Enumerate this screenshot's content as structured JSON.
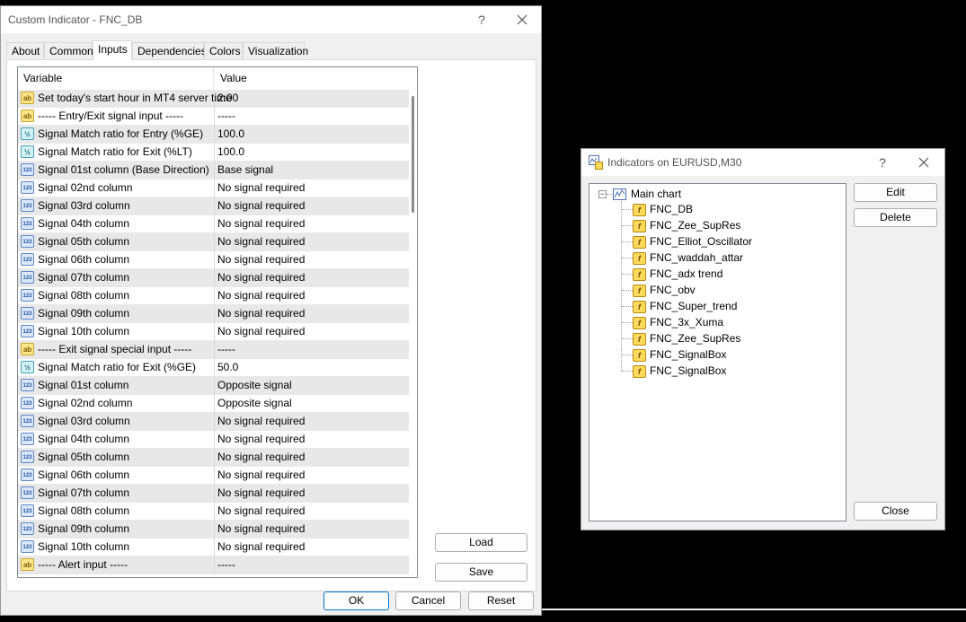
{
  "custom_indicator_dialog": {
    "title": "Custom Indicator - FNC_DB",
    "help_glyph": "?",
    "tabs": [
      {
        "label": "About"
      },
      {
        "label": "Common"
      },
      {
        "label": "Inputs"
      },
      {
        "label": "Dependencies"
      },
      {
        "label": "Colors"
      },
      {
        "label": "Visualization"
      }
    ],
    "active_tab": "Inputs",
    "grid": {
      "col_variable": "Variable",
      "col_value": "Value",
      "rows": [
        {
          "icon": "ab",
          "icon_text": "ab",
          "variable": "Set today's start hour in MT4 server time",
          "value": "2:00"
        },
        {
          "icon": "ab",
          "icon_text": "ab",
          "variable": "----- Entry/Exit signal input -----",
          "value": "-----"
        },
        {
          "icon": "frac",
          "icon_text": "½",
          "variable": "Signal Match ratio for Entry (%GE)",
          "value": "100.0"
        },
        {
          "icon": "frac",
          "icon_text": "½",
          "variable": "Signal Match ratio for Exit (%LT)",
          "value": "100.0"
        },
        {
          "icon": "num",
          "icon_text": "123",
          "variable": "Signal 01st column (Base Direction)",
          "value": "Base signal"
        },
        {
          "icon": "num",
          "icon_text": "123",
          "variable": "Signal 02nd column",
          "value": "No signal required"
        },
        {
          "icon": "num",
          "icon_text": "123",
          "variable": "Signal 03rd column",
          "value": "No signal required"
        },
        {
          "icon": "num",
          "icon_text": "123",
          "variable": "Signal 04th column",
          "value": "No signal required"
        },
        {
          "icon": "num",
          "icon_text": "123",
          "variable": "Signal 05th column",
          "value": "No signal required"
        },
        {
          "icon": "num",
          "icon_text": "123",
          "variable": "Signal 06th column",
          "value": "No signal required"
        },
        {
          "icon": "num",
          "icon_text": "123",
          "variable": "Signal 07th column",
          "value": "No signal required"
        },
        {
          "icon": "num",
          "icon_text": "123",
          "variable": "Signal 08th column",
          "value": "No signal required"
        },
        {
          "icon": "num",
          "icon_text": "123",
          "variable": "Signal 09th column",
          "value": "No signal required"
        },
        {
          "icon": "num",
          "icon_text": "123",
          "variable": "Signal 10th column",
          "value": "No signal required"
        },
        {
          "icon": "ab",
          "icon_text": "ab",
          "variable": "----- Exit signal special input -----",
          "value": "-----"
        },
        {
          "icon": "frac",
          "icon_text": "½",
          "variable": "Signal Match ratio for Exit (%GE)",
          "value": "50.0"
        },
        {
          "icon": "num",
          "icon_text": "123",
          "variable": "Signal 01st column",
          "value": "Opposite signal"
        },
        {
          "icon": "num",
          "icon_text": "123",
          "variable": "Signal 02nd column",
          "value": "Opposite signal"
        },
        {
          "icon": "num",
          "icon_text": "123",
          "variable": "Signal 03rd column",
          "value": "No signal required"
        },
        {
          "icon": "num",
          "icon_text": "123",
          "variable": "Signal 04th column",
          "value": "No signal required"
        },
        {
          "icon": "num",
          "icon_text": "123",
          "variable": "Signal 05th column",
          "value": "No signal required"
        },
        {
          "icon": "num",
          "icon_text": "123",
          "variable": "Signal 06th column",
          "value": "No signal required"
        },
        {
          "icon": "num",
          "icon_text": "123",
          "variable": "Signal 07th column",
          "value": "No signal required"
        },
        {
          "icon": "num",
          "icon_text": "123",
          "variable": "Signal 08th column",
          "value": "No signal required"
        },
        {
          "icon": "num",
          "icon_text": "123",
          "variable": "Signal 09th column",
          "value": "No signal required"
        },
        {
          "icon": "num",
          "icon_text": "123",
          "variable": "Signal 10th column",
          "value": "No signal required"
        },
        {
          "icon": "ab",
          "icon_text": "ab",
          "variable": "----- Alert input -----",
          "value": "-----"
        }
      ]
    },
    "side_buttons": {
      "load": "Load",
      "save": "Save"
    },
    "footer_buttons": {
      "ok": "OK",
      "cancel": "Cancel",
      "reset": "Reset"
    }
  },
  "indicators_dialog": {
    "title": "Indicators on EURUSD,M30",
    "help_glyph": "?",
    "tree": {
      "root": "Main chart",
      "items": [
        "FNC_DB",
        "FNC_Zee_SupRes",
        "FNC_Elliot_Oscillator",
        "FNC_waddah_attar",
        "FNC_adx trend",
        "FNC_obv",
        "FNC_Super_trend",
        "FNC_3x_Xuma",
        "FNC_Zee_SupRes",
        "FNC_SignalBox",
        "FNC_SignalBox"
      ]
    },
    "buttons": {
      "edit": "Edit",
      "delete": "Delete",
      "close": "Close"
    }
  },
  "colors": {
    "background": "#000000",
    "dialog_bg": "#f0f0f0",
    "accent": "#0078d4"
  }
}
